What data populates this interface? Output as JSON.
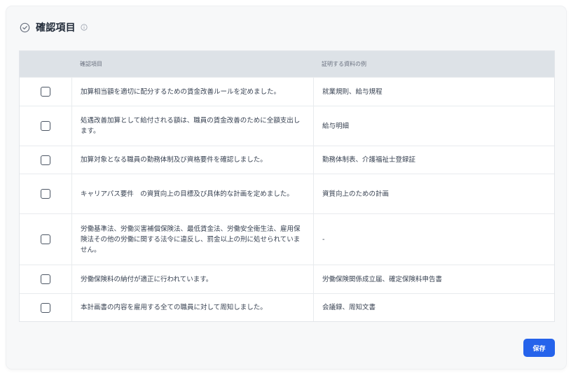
{
  "header": {
    "title": "確認項目"
  },
  "table": {
    "columns": [
      "",
      "確認項目",
      "証明する資料の例"
    ],
    "rows": [
      {
        "item": "加算相当額を適切に配分するための賃金改善ルールを定めました。",
        "doc": "就業規則、給与規程",
        "checked": false
      },
      {
        "item": "処遇改善加算として給付される額は、職員の賃金改善のために全額支出します。",
        "doc": "給与明細",
        "checked": false
      },
      {
        "item": "加算対象となる職員の勤務体制及び資格要件を確認しました。",
        "doc": "勤務体制表、介護福祉士登録証",
        "checked": false
      },
      {
        "item": "キャリアパス要件　の資質向上の目標及び具体的な計画を定めました。",
        "doc": "資質向上のための計画",
        "checked": false
      },
      {
        "item": "労働基準法、労働災害補償保険法、最低賃金法、労働安全衛生法、雇用保険法その他の労働に関する法令に違反し、罰金以上の刑に処せられていません。",
        "doc": "-",
        "checked": false
      },
      {
        "item": "労働保険料の納付が適正に行われています。",
        "doc": "労働保険関係成立届、確定保険料申告書",
        "checked": false
      },
      {
        "item": "本計画書の内容を雇用する全ての職員に対して周知しました。",
        "doc": "会議録、周知文書",
        "checked": false
      }
    ]
  },
  "actions": {
    "save_label": "保存"
  },
  "colors": {
    "accent": "#2563eb",
    "header_bg": "#dde2e7",
    "card_bg": "#f7f8f9"
  },
  "icons": {
    "title_icon": "check-circle-icon",
    "info_icon": "info-icon"
  }
}
